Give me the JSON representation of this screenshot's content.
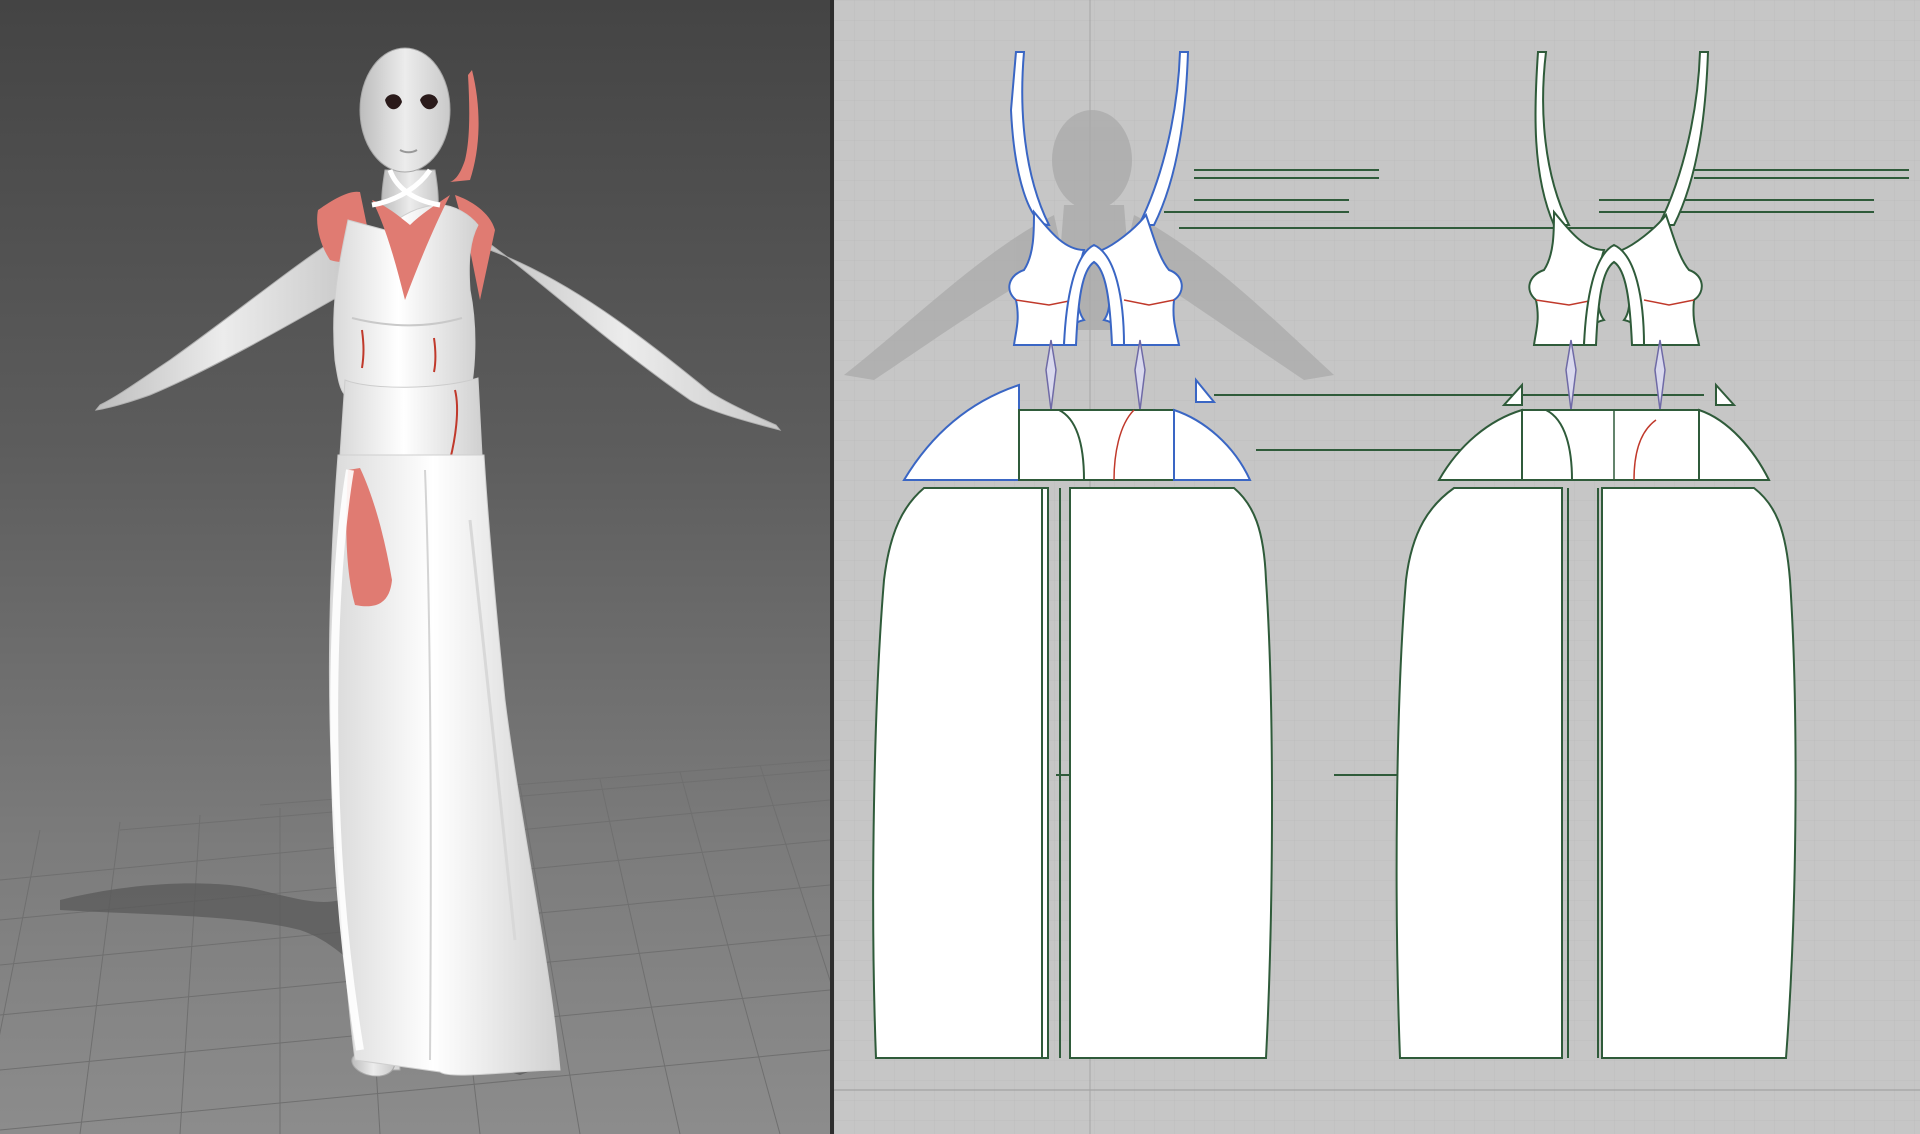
{
  "viewport_3d": {
    "background_top": "#444444",
    "background_bottom": "#8c8c8c",
    "garment_color": "#ffffff",
    "back_face_color": "#e07b72",
    "avatar_color": "#e2e2e2",
    "icon": "avatar-3d-icon"
  },
  "viewport_2d": {
    "background": "#c6c6c6",
    "grid_color": "#b7b7b7",
    "pattern_fill": "#ffffff",
    "outline_green": "#2f5b3a",
    "outline_blue": "#3a66c4",
    "internal_line_red": "#c0392b",
    "dart_color": "#6f6aa6"
  }
}
